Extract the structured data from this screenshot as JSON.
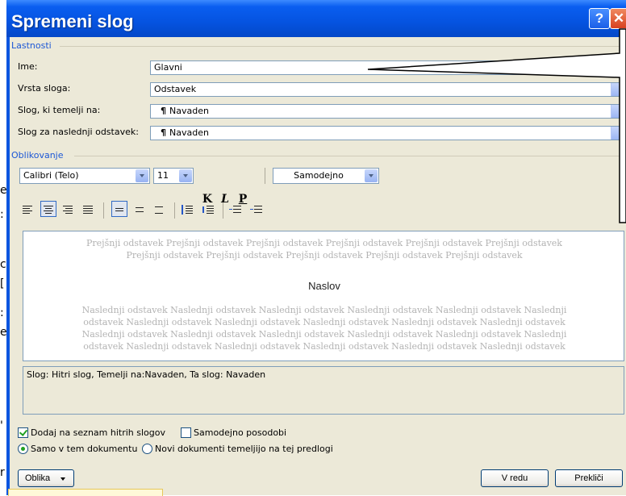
{
  "dialog": {
    "title": "Spremeni slog",
    "help_label": "?",
    "close_label": "✕"
  },
  "properties": {
    "group_label": "Lastnosti",
    "name_label": "Ime:",
    "name_value": "Glavni",
    "type_label": "Vrsta sloga:",
    "type_value": "Odstavek",
    "based_label": "Slog, ki temelji na:",
    "based_value": "Navaden",
    "next_label": "Slog za naslednji odstavek:",
    "next_value": "Navaden"
  },
  "formatting": {
    "group_label": "Oblikovanje",
    "font": "Calibri (Telo)",
    "size": "11",
    "bold": "K",
    "italic": "L",
    "underline": "P",
    "color": "Samodejno"
  },
  "preview": {
    "prev_line1": "Prejšnji odstavek Prejšnji odstavek Prejšnji odstavek Prejšnji odstavek Prejšnji odstavek Prejšnji odstavek",
    "prev_line2": "Prejšnji odstavek Prejšnji odstavek Prejšnji odstavek Prejšnji odstavek Prejšnji odstavek",
    "heading": "Naslov",
    "next_line1": "Naslednji odstavek Naslednji odstavek Naslednji odstavek Naslednji odstavek Naslednji odstavek Naslednji",
    "next_line2": "odstavek Naslednji odstavek Naslednji odstavek Naslednji odstavek Naslednji odstavek Naslednji odstavek",
    "next_line3": "Naslednji odstavek Naslednji odstavek Naslednji odstavek Naslednji odstavek Naslednji odstavek Naslednji",
    "next_line4": "odstavek Naslednji odstavek Naslednji odstavek Naslednji odstavek Naslednji odstavek Naslednji odstavek"
  },
  "description": "Slog: Hitri slog, Temelji na:Navaden, Ta slog: Navaden",
  "options": {
    "add_quick": "Dodaj na seznam hitrih slogov",
    "auto_update": "Samodejno posodobi",
    "only_doc": "Samo v tem dokumentu",
    "new_docs": "Novi dokumenti temeljijo na tej predlogi"
  },
  "buttons": {
    "format": "Oblika",
    "ok": "V redu",
    "cancel": "Prekliči"
  }
}
